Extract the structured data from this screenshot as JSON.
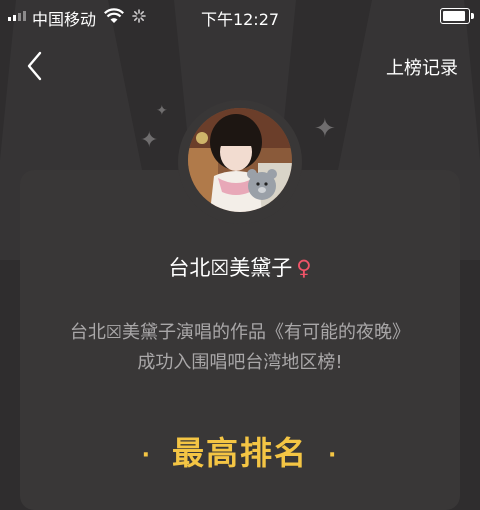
{
  "status_bar": {
    "carrier": "中国移动",
    "time": "下午12:27"
  },
  "nav": {
    "back_icon": "chevron-left-icon",
    "right_link": "上榜记录"
  },
  "profile": {
    "name": "台北☒美黛子",
    "gender_symbol": "♀",
    "gender_color": "#ef5468"
  },
  "description": {
    "line1": "台北☒美黛子演唱的作品《有可能的夜晚》",
    "line2": "成功入围唱吧台湾地区榜!"
  },
  "section": {
    "dot_left": "·",
    "title": "最高排名",
    "dot_right": "·",
    "accent_color": "#f4c544"
  }
}
